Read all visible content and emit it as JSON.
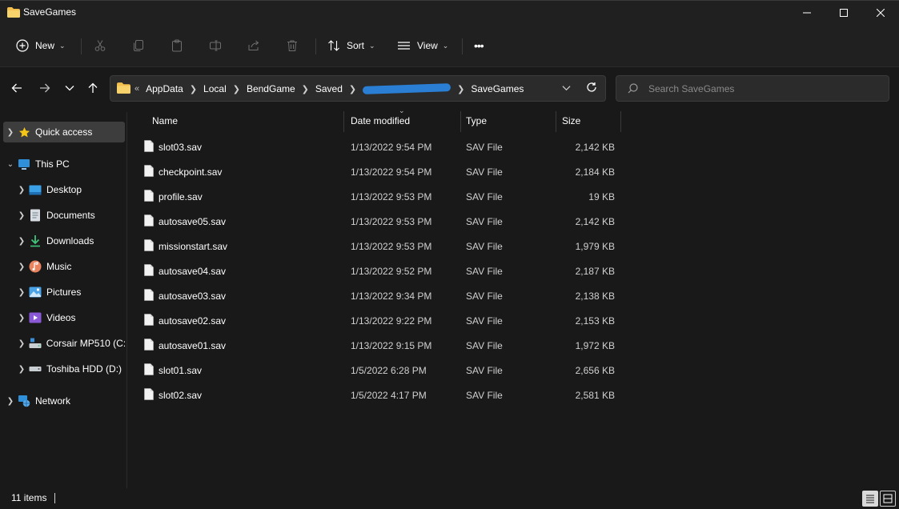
{
  "window": {
    "title": "SaveGames",
    "colors": {
      "accent": "#2a7fd4",
      "folder": "#f3c04f",
      "background": "#191919"
    }
  },
  "toolbar": {
    "new_label": "New",
    "sort_label": "Sort",
    "view_label": "View",
    "more_label": "•••"
  },
  "address": {
    "overflow": "«",
    "crumbs": [
      "AppData",
      "Local",
      "BendGame",
      "Saved",
      "SaveGames"
    ]
  },
  "search": {
    "placeholder": "Search SaveGames"
  },
  "sidebar": {
    "items": [
      {
        "label": "Quick access",
        "icon": "star-icon"
      },
      {
        "label": "This PC",
        "icon": "computer-icon"
      },
      {
        "label": "Desktop",
        "icon": "desktop-icon"
      },
      {
        "label": "Documents",
        "icon": "documents-icon"
      },
      {
        "label": "Downloads",
        "icon": "download-icon"
      },
      {
        "label": "Music",
        "icon": "music-icon"
      },
      {
        "label": "Pictures",
        "icon": "pictures-icon"
      },
      {
        "label": "Videos",
        "icon": "videos-icon"
      },
      {
        "label": "Corsair MP510  (C:",
        "icon": "drive-icon"
      },
      {
        "label": "Toshiba HDD (D:)",
        "icon": "drive-icon"
      },
      {
        "label": "Network",
        "icon": "network-icon"
      }
    ]
  },
  "columns": {
    "name": "Name",
    "date": "Date modified",
    "type": "Type",
    "size": "Size"
  },
  "files": [
    {
      "name": "slot03.sav",
      "date": "1/13/2022 9:54 PM",
      "type": "SAV File",
      "size": "2,142 KB"
    },
    {
      "name": "checkpoint.sav",
      "date": "1/13/2022 9:54 PM",
      "type": "SAV File",
      "size": "2,184 KB"
    },
    {
      "name": "profile.sav",
      "date": "1/13/2022 9:53 PM",
      "type": "SAV File",
      "size": "19 KB"
    },
    {
      "name": "autosave05.sav",
      "date": "1/13/2022 9:53 PM",
      "type": "SAV File",
      "size": "2,142 KB"
    },
    {
      "name": "missionstart.sav",
      "date": "1/13/2022 9:53 PM",
      "type": "SAV File",
      "size": "1,979 KB"
    },
    {
      "name": "autosave04.sav",
      "date": "1/13/2022 9:52 PM",
      "type": "SAV File",
      "size": "2,187 KB"
    },
    {
      "name": "autosave03.sav",
      "date": "1/13/2022 9:34 PM",
      "type": "SAV File",
      "size": "2,138 KB"
    },
    {
      "name": "autosave02.sav",
      "date": "1/13/2022 9:22 PM",
      "type": "SAV File",
      "size": "2,153 KB"
    },
    {
      "name": "autosave01.sav",
      "date": "1/13/2022 9:15 PM",
      "type": "SAV File",
      "size": "1,972 KB"
    },
    {
      "name": "slot01.sav",
      "date": "1/5/2022 6:28 PM",
      "type": "SAV File",
      "size": "2,656 KB"
    },
    {
      "name": "slot02.sav",
      "date": "1/5/2022 4:17 PM",
      "type": "SAV File",
      "size": "2,581 KB"
    }
  ],
  "status": {
    "count": "11 items"
  }
}
